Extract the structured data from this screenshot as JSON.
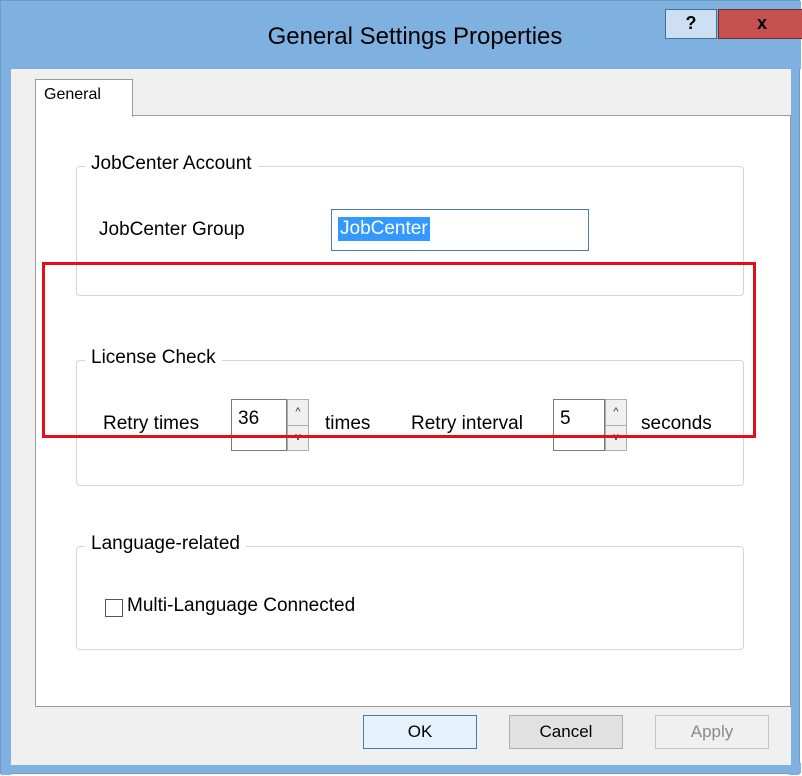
{
  "window": {
    "title": "General Settings Properties",
    "help_label": "?",
    "close_label": "x",
    "colors": {
      "frame": "#7fb1e0",
      "close": "#c75050",
      "highlight": "#e0101a",
      "selection": "#3399ff"
    }
  },
  "tabs": [
    {
      "label": "General",
      "active": true
    }
  ],
  "jobcenter_account": {
    "group_title": "JobCenter Account",
    "group_label": "JobCenter Group",
    "group_value": "JobCenter"
  },
  "license_check": {
    "group_title": "License Check",
    "retry_times_label": "Retry times",
    "retry_times_value": "36",
    "retry_times_unit": "times",
    "retry_interval_label": "Retry interval",
    "retry_interval_value": "5",
    "retry_interval_unit": "seconds",
    "spin_up_icon": "^",
    "spin_down_icon": "v"
  },
  "language": {
    "group_title": "Language-related",
    "multi_language_label": "Multi-Language Connected",
    "multi_language_checked": false
  },
  "buttons": {
    "ok": "OK",
    "cancel": "Cancel",
    "apply": "Apply"
  }
}
